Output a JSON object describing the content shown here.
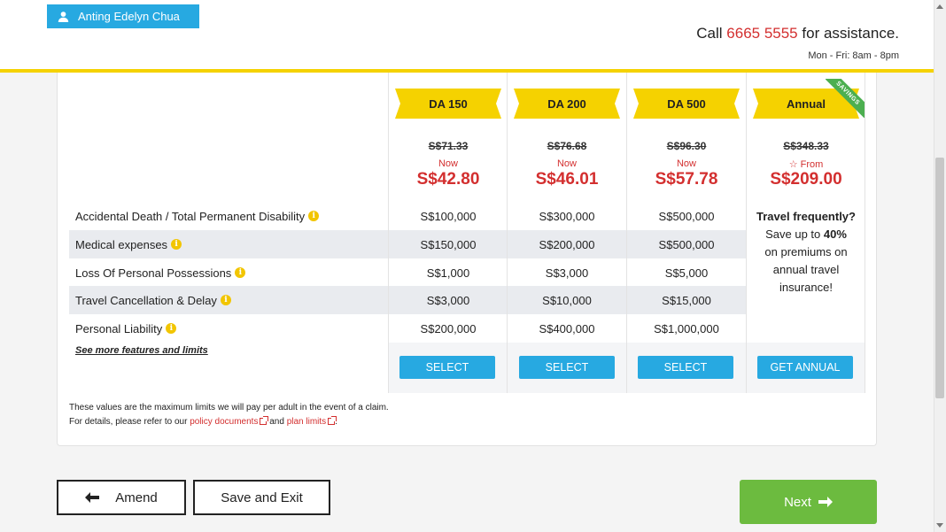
{
  "user": {
    "name": "Anting Edelyn Chua",
    "icon": "user-icon"
  },
  "help": {
    "prefix": "Call",
    "phone": "6665 5555",
    "suffix": "for assistance.",
    "hours": "Mon - Fri: 8am - 8pm"
  },
  "plans": [
    {
      "name": "DA 150",
      "old_price": "S$71.33",
      "now_label": "Now",
      "price": "S$42.80",
      "button": "SELECT"
    },
    {
      "name": "DA 200",
      "old_price": "S$76.68",
      "now_label": "Now",
      "price": "S$46.01",
      "button": "SELECT"
    },
    {
      "name": "DA 500",
      "old_price": "S$96.30",
      "now_label": "Now",
      "price": "S$57.78",
      "button": "SELECT"
    },
    {
      "name": "Annual",
      "old_price": "S$348.33",
      "now_label": "From",
      "price": "S$209.00",
      "button": "GET ANNUAL",
      "badge": "SAVINGS"
    }
  ],
  "annual_promo": {
    "line1": "Travel frequently?",
    "line2a": "Save up to",
    "line2b": "40%",
    "line3": "on premiums on",
    "line4": "annual travel",
    "line5": "insurance!"
  },
  "rows": [
    {
      "label": "Accidental Death / Total Permanent Disability",
      "values": [
        "S$100,000",
        "S$300,000",
        "S$500,000"
      ]
    },
    {
      "label": "Medical expenses",
      "values": [
        "S$150,000",
        "S$200,000",
        "S$500,000"
      ]
    },
    {
      "label": "Loss Of Personal Possessions",
      "values": [
        "S$1,000",
        "S$3,000",
        "S$5,000"
      ]
    },
    {
      "label": "Travel Cancellation & Delay",
      "values": [
        "S$3,000",
        "S$10,000",
        "S$15,000"
      ]
    },
    {
      "label": "Personal Liability",
      "values": [
        "S$200,000",
        "S$400,000",
        "S$1,000,000"
      ]
    }
  ],
  "see_more": "See more features and limits",
  "notes": {
    "line1": "These values are the maximum limits we will pay per adult in the event of a claim.",
    "line2_prefix": "For details, please refer to our",
    "policy_link": "policy documents",
    "and": "and",
    "limits_link": "plan limits",
    "period": "."
  },
  "footer": {
    "amend": "Amend",
    "save_exit": "Save and Exit",
    "next": "Next"
  },
  "colors": {
    "accent_blue": "#27a9e1",
    "brand_yellow": "#f5d200",
    "price_red": "#d32f2f",
    "next_green": "#6cbb3f"
  }
}
